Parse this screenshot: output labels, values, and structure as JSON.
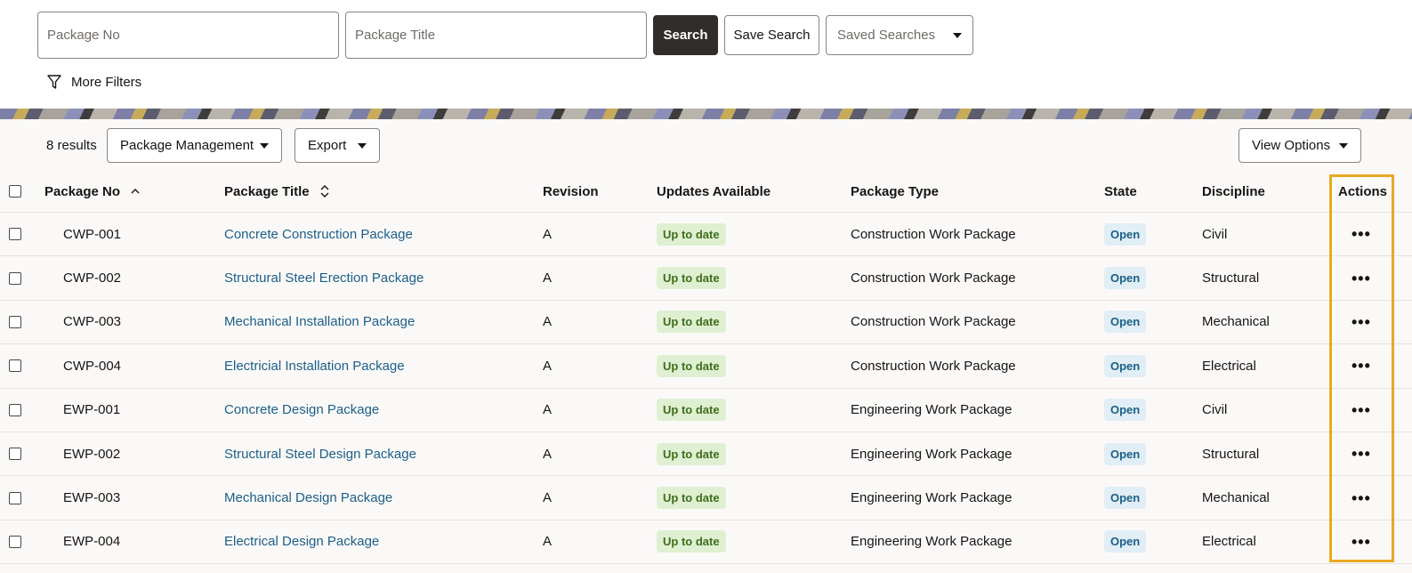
{
  "search": {
    "package_no_placeholder": "Package No",
    "package_title_placeholder": "Package Title",
    "search_label": "Search",
    "save_search_label": "Save Search",
    "saved_searches_label": "Saved Searches",
    "more_filters_label": "More Filters"
  },
  "toolbar": {
    "results_count": "8 results",
    "package_management_label": "Package Management",
    "export_label": "Export",
    "view_options_label": "View Options"
  },
  "table": {
    "headers": {
      "package_no": "Package No",
      "package_title": "Package Title",
      "revision": "Revision",
      "updates_available": "Updates Available",
      "package_type": "Package Type",
      "state": "State",
      "discipline": "Discipline",
      "actions": "Actions"
    },
    "rows": [
      {
        "no": "CWP-001",
        "title": "Concrete Construction Package",
        "revision": "A",
        "updates": "Up to date",
        "type": "Construction Work Package",
        "state": "Open",
        "discipline": "Civil"
      },
      {
        "no": "CWP-002",
        "title": "Structural Steel Erection Package",
        "revision": "A",
        "updates": "Up to date",
        "type": "Construction Work Package",
        "state": "Open",
        "discipline": "Structural"
      },
      {
        "no": "CWP-003",
        "title": "Mechanical Installation Package",
        "revision": "A",
        "updates": "Up to date",
        "type": "Construction Work Package",
        "state": "Open",
        "discipline": "Mechanical"
      },
      {
        "no": "CWP-004",
        "title": "Electricial Installation Package",
        "revision": "A",
        "updates": "Up to date",
        "type": "Construction Work Package",
        "state": "Open",
        "discipline": "Electrical"
      },
      {
        "no": "EWP-001",
        "title": "Concrete Design Package",
        "revision": "A",
        "updates": "Up to date",
        "type": "Engineering Work Package",
        "state": "Open",
        "discipline": "Civil"
      },
      {
        "no": "EWP-002",
        "title": "Structural Steel Design Package",
        "revision": "A",
        "updates": "Up to date",
        "type": "Engineering Work Package",
        "state": "Open",
        "discipline": "Structural"
      },
      {
        "no": "EWP-003",
        "title": "Mechanical Design Package",
        "revision": "A",
        "updates": "Up to date",
        "type": "Engineering Work Package",
        "state": "Open",
        "discipline": "Mechanical"
      },
      {
        "no": "EWP-004",
        "title": "Electrical Design Package",
        "revision": "A",
        "updates": "Up to date",
        "type": "Engineering Work Package",
        "state": "Open",
        "discipline": "Electrical"
      }
    ],
    "actions_glyph": "•••"
  },
  "colors": {
    "primary_button": "#312d2a",
    "link": "#1b5f87",
    "up_to_date_bg": "#dff0d2",
    "open_badge_bg": "#e1eef5",
    "highlight": "#e8a922"
  },
  "icons": {
    "filter": "filter-icon",
    "dropdown": "chevron-down-icon",
    "sort_asc": "sort-ascending-icon",
    "sort_both": "sort-icon",
    "more": "more-horizontal-icon"
  }
}
